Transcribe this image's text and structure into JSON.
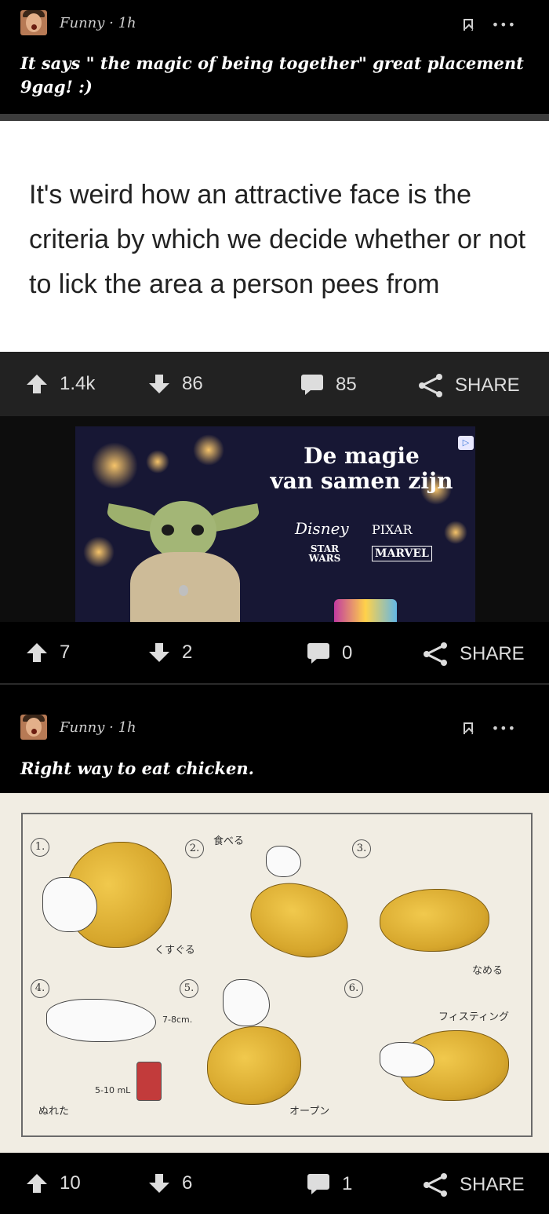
{
  "post1": {
    "section": "Funny",
    "time": "1h",
    "title": "It says \" the magic of being together\" great placement 9gag! :)",
    "image_text": "It's weird how an attractive face is the criteria by which we decide whether or not to lick the area a person pees from",
    "upvotes": "1.4k",
    "downvotes": "86",
    "comments": "85",
    "share_label": "SHARE"
  },
  "ad": {
    "headline_line1": "De magie",
    "headline_line2": "van samen zijn",
    "brands": {
      "disney": "Disney",
      "pixar": "PIXAR",
      "starwars": "STAR WARS",
      "marvel": "MARVEL"
    },
    "upvotes": "7",
    "downvotes": "2",
    "comments": "0",
    "share_label": "SHARE"
  },
  "post2": {
    "section": "Funny",
    "time": "1h",
    "title": "Right way to eat chicken.",
    "comic": {
      "labels": {
        "p1": "1.",
        "p2": "2.",
        "p3": "3.",
        "p4": "4.",
        "p5": "5.",
        "p6": "6.",
        "taberu": "食べる",
        "kusuguru": "くすぐる",
        "nameru": "なめる",
        "fisting": "フィスティング",
        "measure_cm": "7-8cm.",
        "measure_ml": "5-10 mL",
        "nureta": "ぬれた",
        "open": "オープン"
      }
    },
    "upvotes": "10",
    "downvotes": "6",
    "comments": "1",
    "share_label": "SHARE"
  },
  "colors": {
    "background": "#000000",
    "action_bar": "#222222",
    "text_light": "#dddddd",
    "ad_background": "#171734"
  },
  "icons": [
    "avatar",
    "bookmark-icon",
    "more-icon",
    "upvote-icon",
    "downvote-icon",
    "comment-icon",
    "share-icon"
  ]
}
